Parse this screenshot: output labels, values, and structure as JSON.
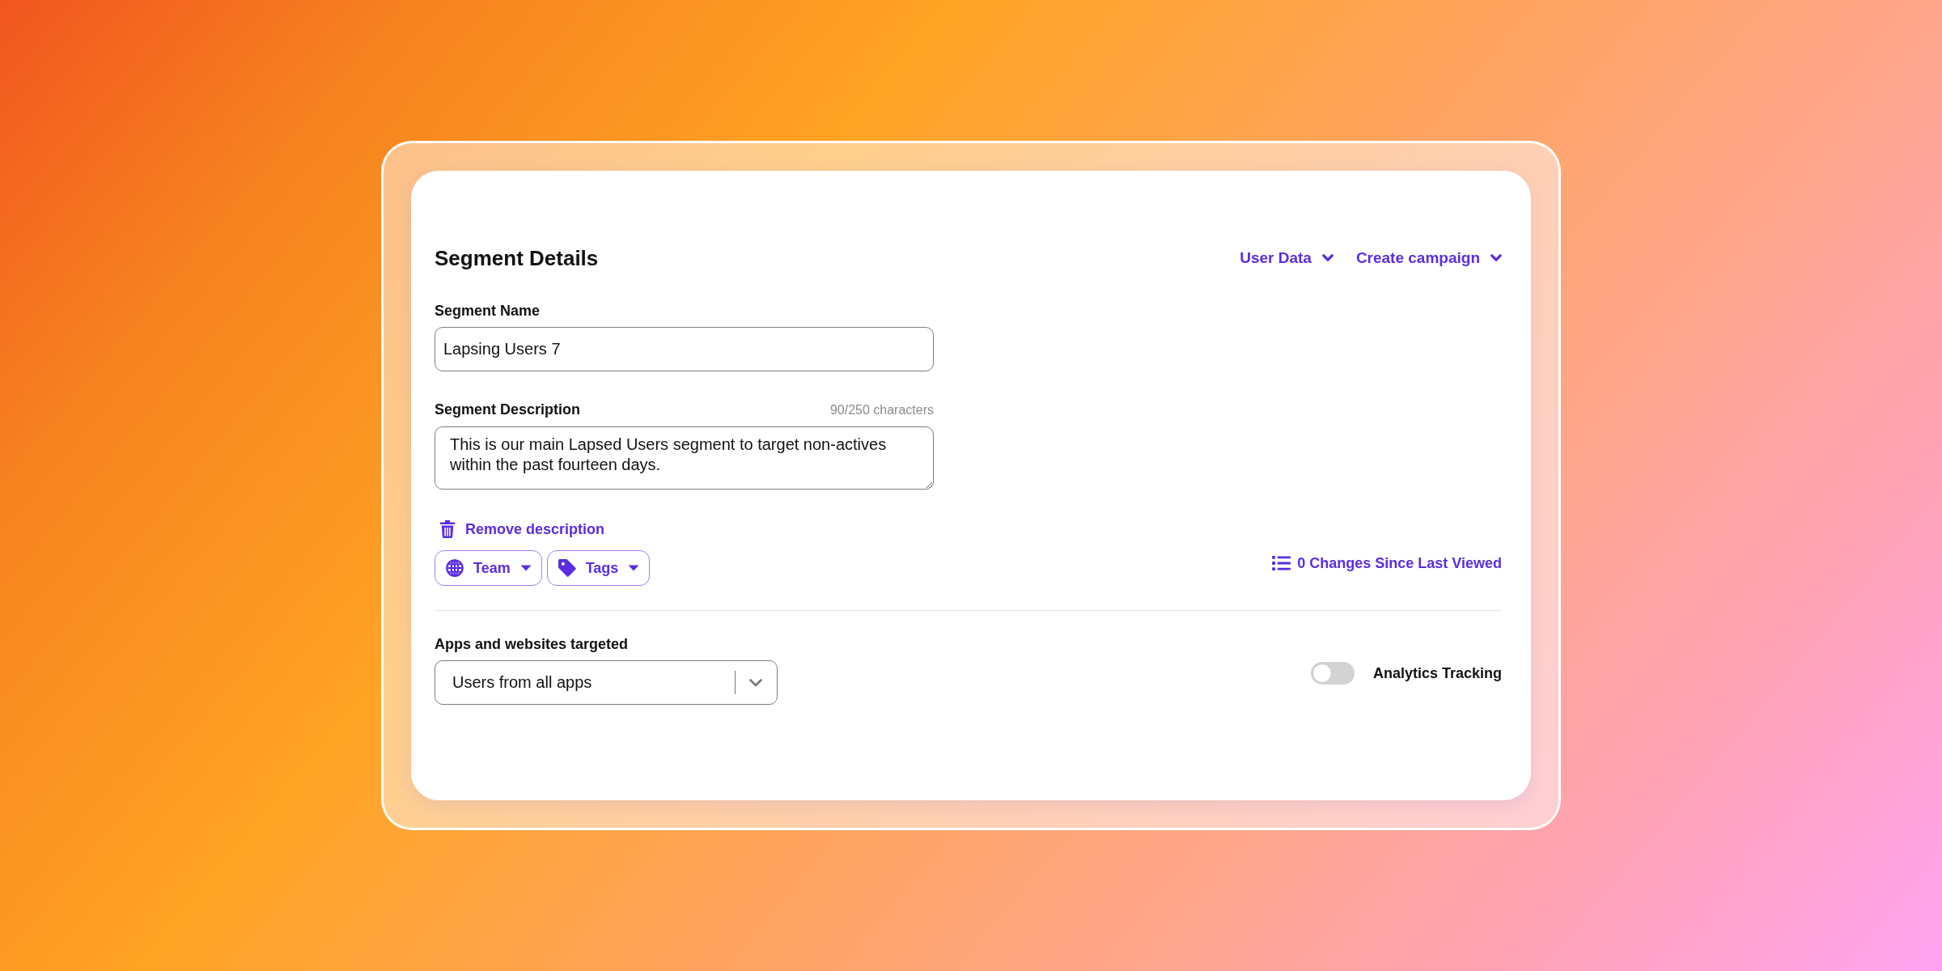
{
  "header": {
    "title": "Segment Details",
    "menus": [
      {
        "label": "User Data"
      },
      {
        "label": "Create campaign"
      }
    ]
  },
  "segment_name": {
    "label": "Segment Name",
    "value": "Lapsing Users 7"
  },
  "segment_description": {
    "label": "Segment Description",
    "counter": "90/250 characters",
    "value": "This is our main Lapsed Users segment to target non-actives within the past fourteen days."
  },
  "remove_description": {
    "label": "Remove description"
  },
  "filters": [
    {
      "kind": "team",
      "label": "Team"
    },
    {
      "kind": "tags",
      "label": "Tags"
    }
  ],
  "changes_link": {
    "label": "0 Changes Since Last Viewed"
  },
  "apps_targeted": {
    "label": "Apps and websites targeted",
    "value": "Users from all apps"
  },
  "analytics_tracking": {
    "label": "Analytics Tracking",
    "on": false
  }
}
